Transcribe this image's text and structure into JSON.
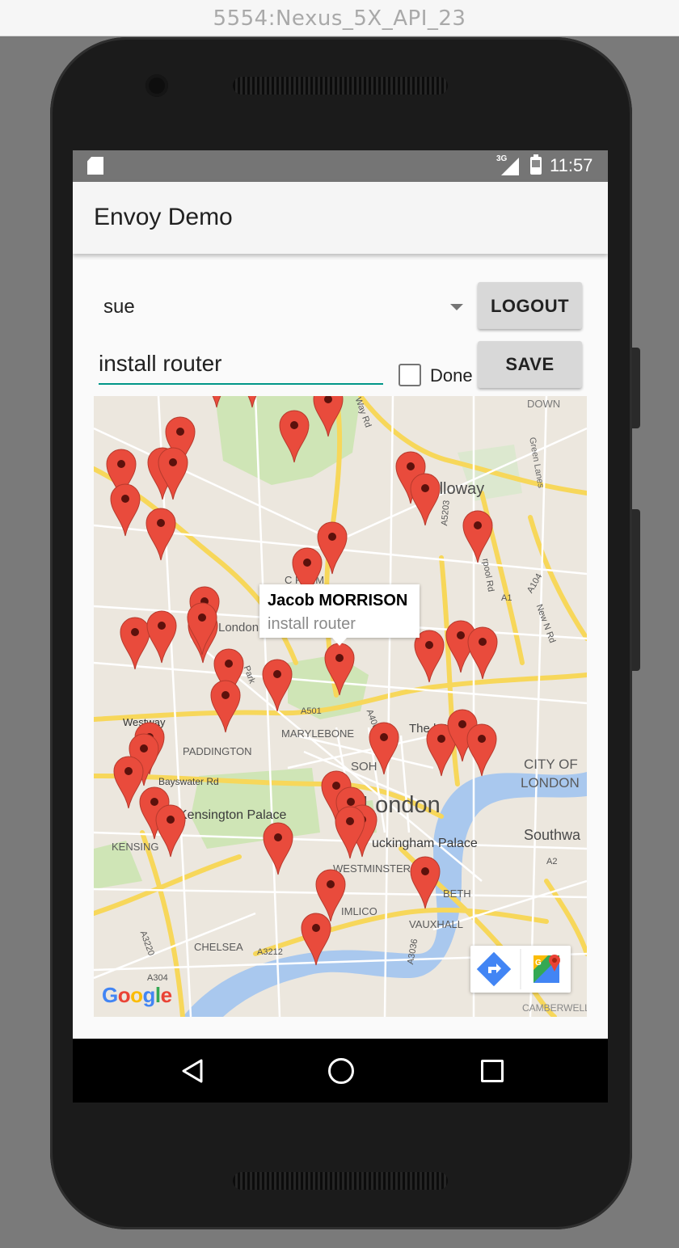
{
  "window": {
    "title": "5554:Nexus_5X_API_23"
  },
  "status_bar": {
    "network": "3G",
    "time": "11:57"
  },
  "app": {
    "title": "Envoy Demo"
  },
  "form": {
    "user_spinner_value": "sue",
    "logout_label": "LOGOUT",
    "save_label": "SAVE",
    "task_value": "install router",
    "done_label": "Done",
    "done_checked": false
  },
  "map": {
    "info_window": {
      "title": "Jacob MORRISON",
      "subtitle": "install router"
    },
    "labels": {
      "holloway": "Holloway",
      "london_small": "London",
      "marylebone": "MARYLEBONE",
      "paddington": "PADDINGTON",
      "westway": "Westway",
      "bayswater": "Bayswater Rd",
      "kensington_palace": "Kensington Palace",
      "kensington": "KENSING",
      "london_big": "London",
      "buckingham": "uckingham Palace",
      "westminster": "WESTMINSTER",
      "pimlico": "IMLICO",
      "vauxhall": "VAUXHALL",
      "lambeth": "BETH",
      "chelsea": "CHELSEA",
      "city_of": "CITY OF",
      "city_london": "LONDON",
      "southwark": "Southwa",
      "museum": "The    h Museum",
      "soho": "SOH",
      "down": "DOWN",
      "green_lanes": "Green Lanes",
      "camberwell": "CAMBERWELL",
      "a501": "A501",
      "a3212": "A3212",
      "a3220": "A3220",
      "a304": "A304",
      "a400": "A400",
      "a5203": "A5203",
      "a1": "A1",
      "a104": "A104",
      "a3036": "A3036",
      "a2": "A2",
      "new_n_rd": "New N Rd",
      "park": "Park",
      "farm": "C         FARM",
      "pool_rd": "rpool Rd",
      "way_rd": "Way Rd"
    },
    "marker_count": 43,
    "google_logo": "Google"
  },
  "icons": {
    "sd_card": "sd-card-icon",
    "signal": "signal-icon",
    "battery": "battery-icon",
    "directions": "directions-icon",
    "maps_app": "google-maps-icon",
    "back": "back-icon",
    "home": "home-icon",
    "recents": "recents-icon"
  },
  "colors": {
    "marker": "#e94b3c",
    "accent": "#009688",
    "app_bar": "#f5f5f5",
    "status_bar": "#757575"
  }
}
